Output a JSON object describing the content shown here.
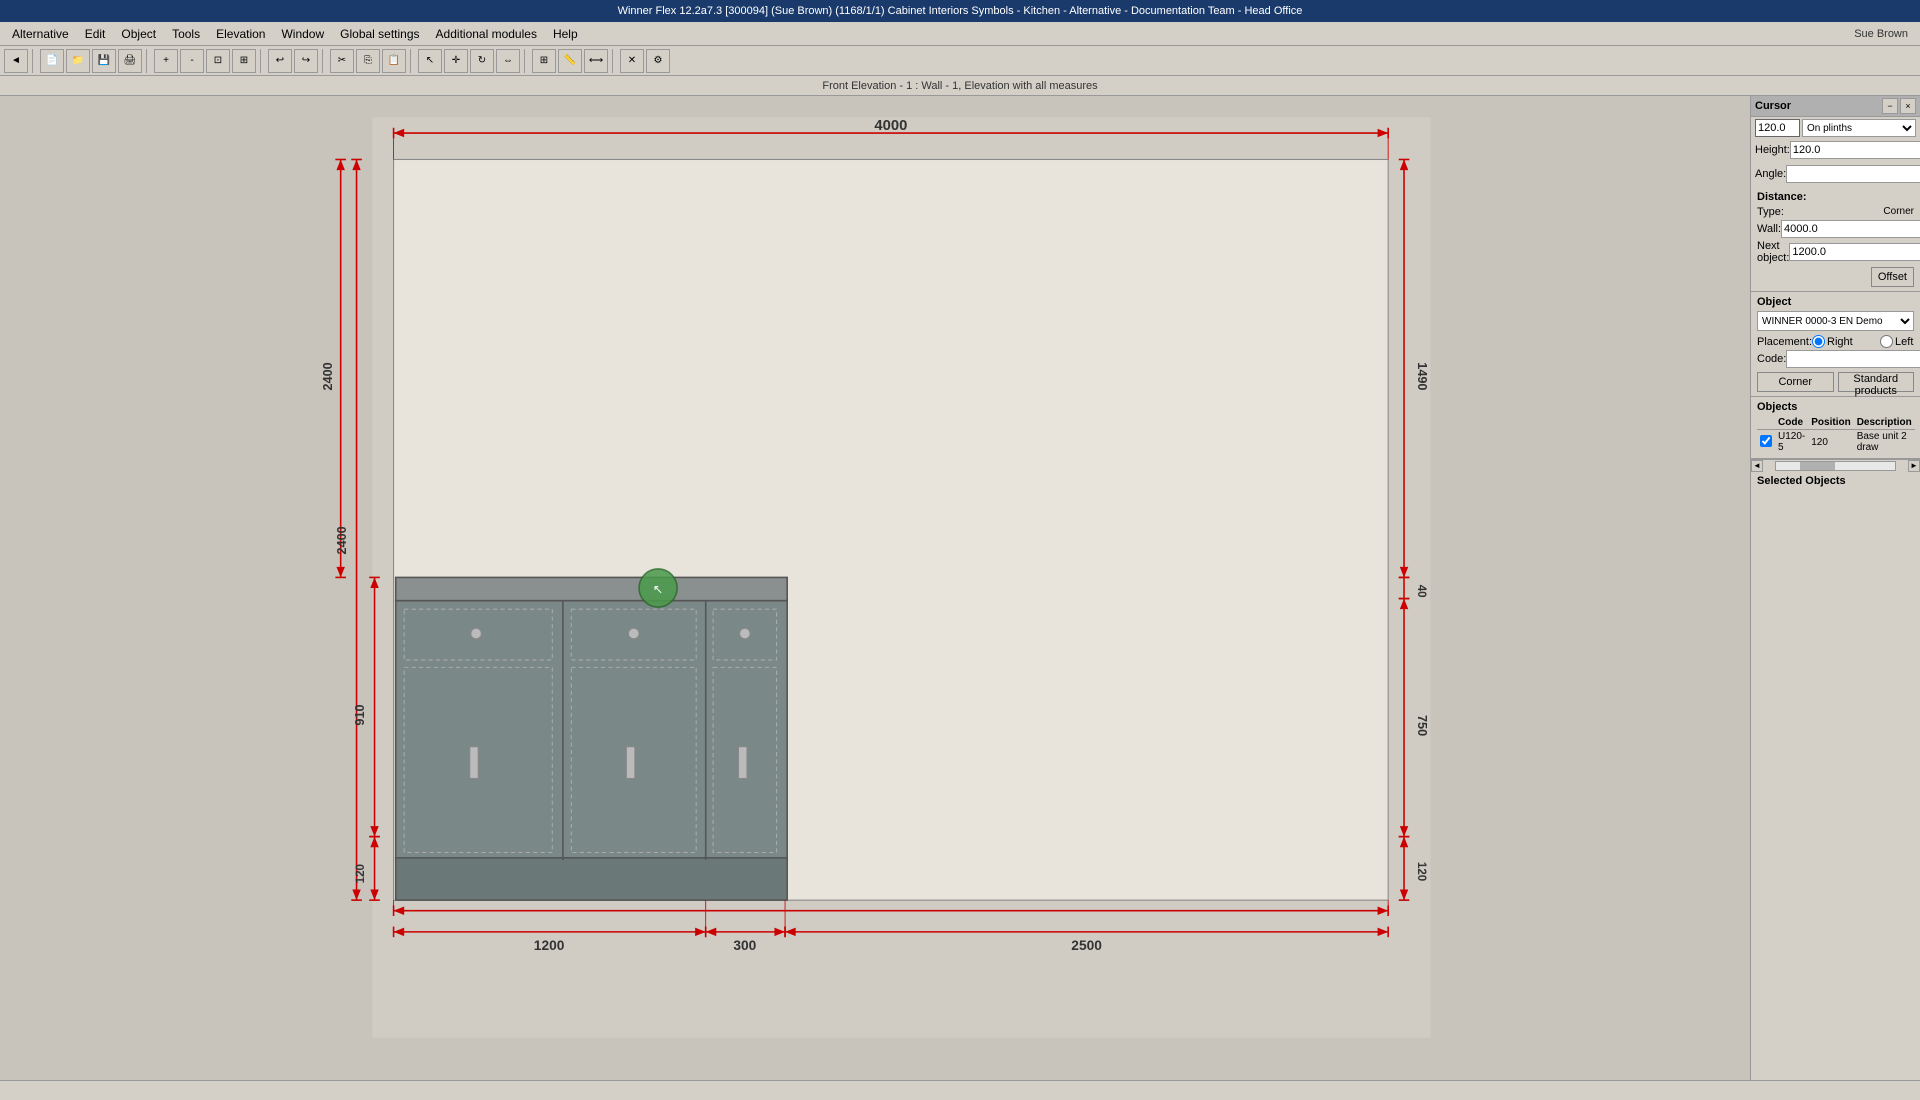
{
  "titlebar": {
    "text": "Winner Flex 12.2a7.3  [300094]  (Sue Brown)  (1168/1/1) Cabinet Interiors Symbols - Kitchen - Alternative - Documentation Team - Head Office"
  },
  "menubar": {
    "items": [
      "Alternative",
      "Edit",
      "Object",
      "Tools",
      "Elevation",
      "Window",
      "Global settings",
      "Additional modules",
      "Help"
    ]
  },
  "status_top": {
    "text": "Front Elevation - 1 : Wall - 1, Elevation with all measures"
  },
  "cursor_panel": {
    "label": "Cursor",
    "value": "120.0",
    "dropdown_value": "On plinths",
    "height_label": "Height:",
    "height_value": "120.0",
    "angle_label": "Angle:",
    "angle_value": ""
  },
  "distance_panel": {
    "label": "Distance:",
    "type_label": "Type:",
    "type_value": "",
    "corner_label": "Corner",
    "wall_label": "Wall:",
    "wall_value": "4000.0",
    "next_obj_label": "Next object:",
    "next_obj_value": "1200.0",
    "offset_btn": "Offset"
  },
  "object_panel": {
    "label": "Object",
    "dropdown_value": "WINNER 0000-3 EN Demo",
    "placement_label": "Placement:",
    "right_label": "Right",
    "left_label": "Left",
    "code_label": "Code:",
    "code_value": "",
    "corner_btn": "Corner",
    "std_products_btn": "Standard products"
  },
  "objects_panel": {
    "label": "Objects",
    "columns": [
      "Code",
      "Position",
      "Description"
    ],
    "rows": [
      {
        "checkbox": true,
        "code": "U120-5",
        "position": "120",
        "description": "Base unit 2 draw"
      }
    ]
  },
  "selected_objects_panel": {
    "label": "Selected Objects"
  },
  "drawing": {
    "dimension_top": "4000",
    "dimension_left_top": "2400",
    "dimension_left_mid": "910",
    "dimension_left_bot": "120",
    "dimension_right_top": "1490",
    "dimension_right_mid": "40",
    "dimension_right_bot2": "750",
    "dimension_right_bot3": "120",
    "dimension_bottom_left": "1200",
    "dimension_bottom_mid": "300",
    "dimension_bottom_right": "2500",
    "dim_left_2400": "2400"
  },
  "user": {
    "name": "Sue Brown"
  },
  "statusbar": {
    "text": ""
  }
}
